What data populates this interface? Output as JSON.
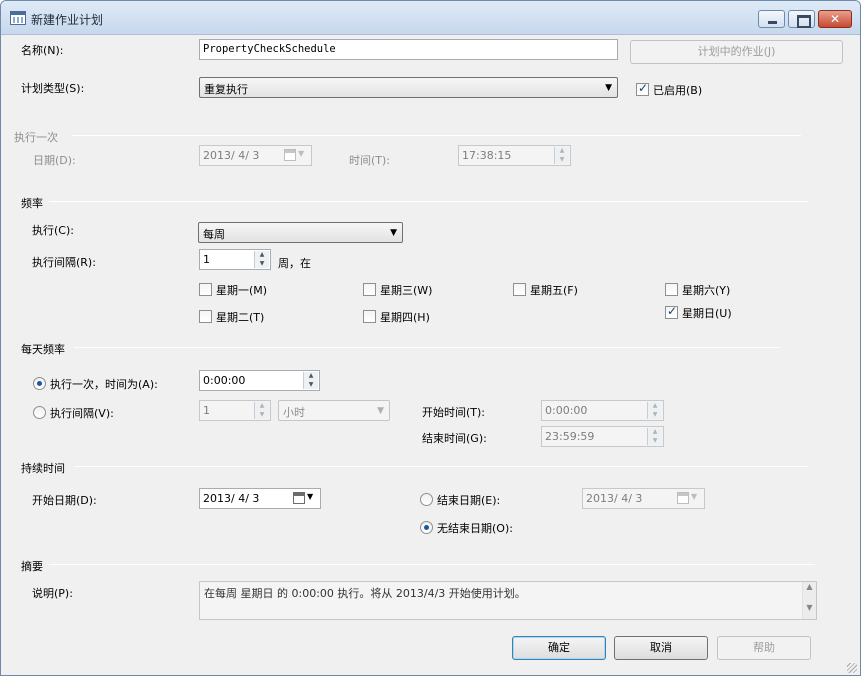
{
  "window": {
    "title": "新建作业计划"
  },
  "name": {
    "label": "名称(N):",
    "value": "PropertyCheckSchedule"
  },
  "jobs_button": {
    "label": "计划中的作业(J)"
  },
  "schedule_type": {
    "label": "计划类型(S):",
    "value": "重复执行"
  },
  "enabled": {
    "label": "已启用(B)",
    "checked": true
  },
  "once": {
    "header": "执行一次",
    "date_label": "日期(D):",
    "date_value": "2013/ 4/ 3",
    "time_label": "时间(T):",
    "time_value": "17:38:15"
  },
  "frequency": {
    "header": "频率",
    "occurs_label": "执行(C):",
    "occurs_value": "每周",
    "recurs_label": "执行间隔(R):",
    "recurs_value": "1",
    "recurs_suffix": "周，在",
    "days": [
      {
        "label": "星期一(M)",
        "checked": false
      },
      {
        "label": "星期二(T)",
        "checked": false
      },
      {
        "label": "星期三(W)",
        "checked": false
      },
      {
        "label": "星期四(H)",
        "checked": false
      },
      {
        "label": "星期五(F)",
        "checked": false
      },
      {
        "label": "星期六(Y)",
        "checked": false
      },
      {
        "label": "星期日(U)",
        "checked": true
      }
    ]
  },
  "daily": {
    "header": "每天频率",
    "once_label": "执行一次，时间为(A):",
    "once_value": "0:00:00",
    "every_label": "执行间隔(V):",
    "every_value": "1",
    "every_unit": "小时",
    "start_label": "开始时间(T):",
    "start_value": "0:00:00",
    "end_label": "结束时间(G):",
    "end_value": "23:59:59",
    "selected": "once"
  },
  "duration": {
    "header": "持续时间",
    "start_label": "开始日期(D):",
    "start_value": "2013/ 4/ 3",
    "end_label": "结束日期(E):",
    "end_value": "2013/ 4/ 3",
    "no_end_label": "无结束日期(O):",
    "selected": "no_end"
  },
  "summary": {
    "header": "摘要",
    "desc_label": "说明(P):",
    "desc_value": "在每周 星期日 的 0:00:00 执行。将从 2013/4/3 开始使用计划。"
  },
  "buttons": {
    "ok": "确定",
    "cancel": "取消",
    "help": "帮助"
  }
}
